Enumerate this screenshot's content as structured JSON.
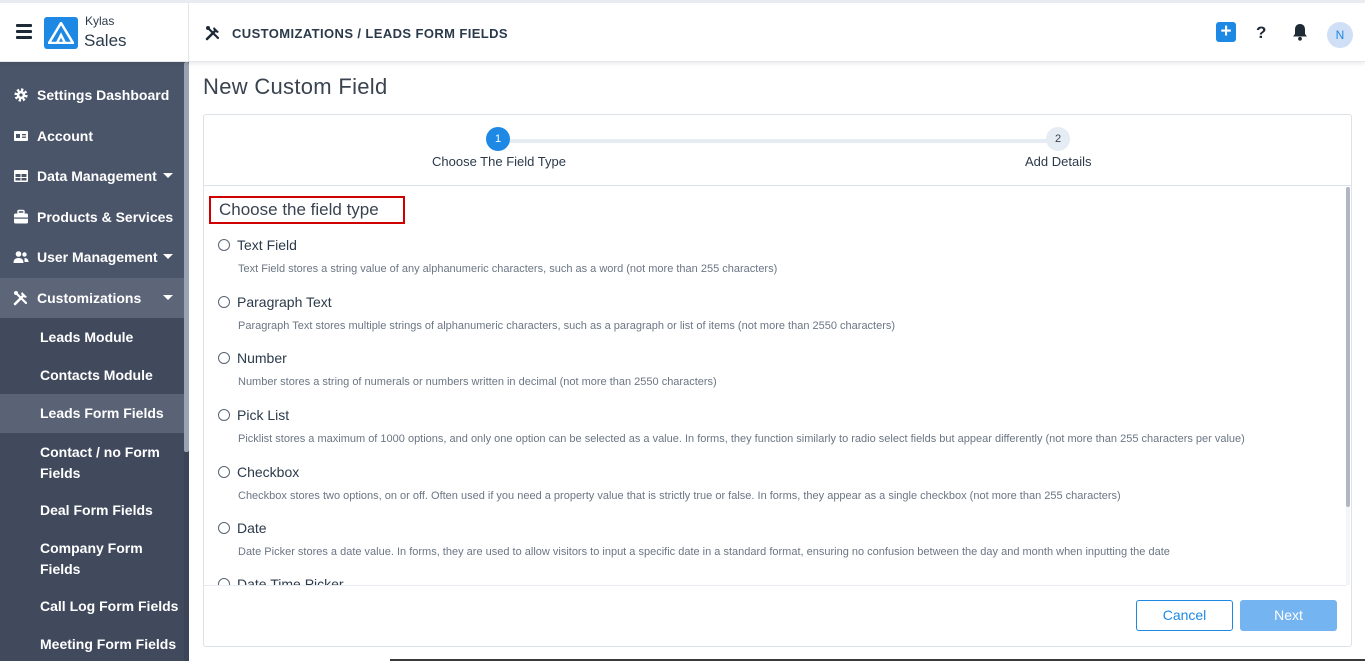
{
  "app": {
    "brand_top": "Kylas",
    "brand_bottom": "Sales"
  },
  "header": {
    "breadcrumb": "CUSTOMIZATIONS / LEADS FORM FIELDS",
    "add_label": "+",
    "help_label": "?",
    "avatar_initial": "N"
  },
  "sidebar": {
    "items": [
      {
        "label": "Settings Dashboard",
        "icon": "gear-icon"
      },
      {
        "label": "Account",
        "icon": "id-card-icon"
      },
      {
        "label": "Data Management",
        "icon": "table-icon"
      },
      {
        "label": "Products & Services",
        "icon": "briefcase-icon"
      },
      {
        "label": "User Management",
        "icon": "users-icon"
      },
      {
        "label": "Customizations",
        "icon": "tools-icon"
      }
    ],
    "sub_items": [
      {
        "label": "Leads Module"
      },
      {
        "label": "Contacts Module"
      },
      {
        "label": "Leads Form Fields"
      },
      {
        "label": "Contact / no Form Fields"
      },
      {
        "label": "Deal Form Fields"
      },
      {
        "label": "Company Form Fields"
      },
      {
        "label": "Call Log Form Fields"
      },
      {
        "label": "Meeting Form Fields"
      }
    ]
  },
  "main": {
    "title": "New Custom Field",
    "steps": [
      {
        "number": "1",
        "label": "Choose The Field Type"
      },
      {
        "number": "2",
        "label": "Add Details"
      }
    ],
    "section_heading": "Choose the field type",
    "options": [
      {
        "name": "Text Field",
        "desc": "Text Field stores a string value of any alphanumeric characters, such as a word (not more than 255 characters)"
      },
      {
        "name": "Paragraph Text",
        "desc": "Paragraph Text stores multiple strings of alphanumeric characters, such as a paragraph or list of items (not more than 2550 characters)"
      },
      {
        "name": "Number",
        "desc": "Number stores a string of numerals or numbers written in decimal (not more than 2550 characters)"
      },
      {
        "name": "Pick List",
        "desc": "Picklist stores a maximum of 1000 options, and only one option can be selected as a value. In forms, they function similarly to radio select fields but appear differently (not more than 255 characters per value)"
      },
      {
        "name": "Checkbox",
        "desc": "Checkbox stores two options, on or off. Often used if you need a property value that is strictly true or false. In forms, they appear as a single checkbox (not more than 255 characters)"
      },
      {
        "name": "Date",
        "desc": "Date Picker stores a date value. In forms, they are used to allow visitors to input a specific date in a standard format, ensuring no confusion between the day and month when inputting the date"
      },
      {
        "name": "Date Time Picker",
        "desc": ""
      }
    ],
    "cancel_label": "Cancel",
    "next_label": "Next"
  },
  "colors": {
    "accent": "#1e88e5",
    "sidebar_bg": "#4b5569",
    "highlight_border": "#d00000"
  }
}
